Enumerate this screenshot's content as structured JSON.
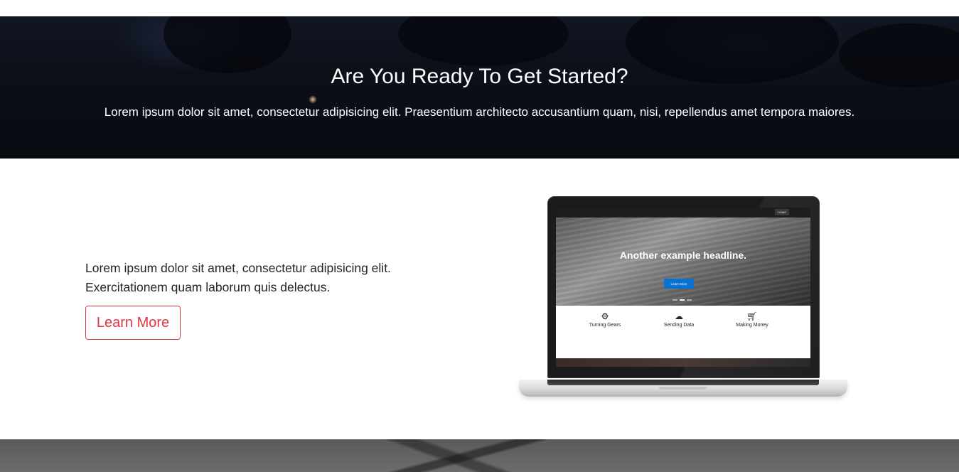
{
  "cta": {
    "title": "Are You Ready To Get Started?",
    "text": "Lorem ipsum dolor sit amet, consectetur adipisicing elit. Praesentium architecto accusantium quam, nisi, repellendus amet tempora maiores."
  },
  "feature": {
    "text": "Lorem ipsum dolor sit amet, consectetur adipisicing elit. Exercitationem quam laborum quis delectus.",
    "button_label": "Learn More",
    "accent_color": "#dc3545"
  },
  "laptop_screen": {
    "nav_items": [
      "HOME",
      "",
      ""
    ],
    "headline": "Another example headline.",
    "button_label": "Learn More",
    "features": [
      {
        "icon": "gear-icon",
        "title": "Turning Gears"
      },
      {
        "icon": "cloud-icon",
        "title": "Sending Data"
      },
      {
        "icon": "cart-icon",
        "title": "Making Money"
      }
    ]
  }
}
